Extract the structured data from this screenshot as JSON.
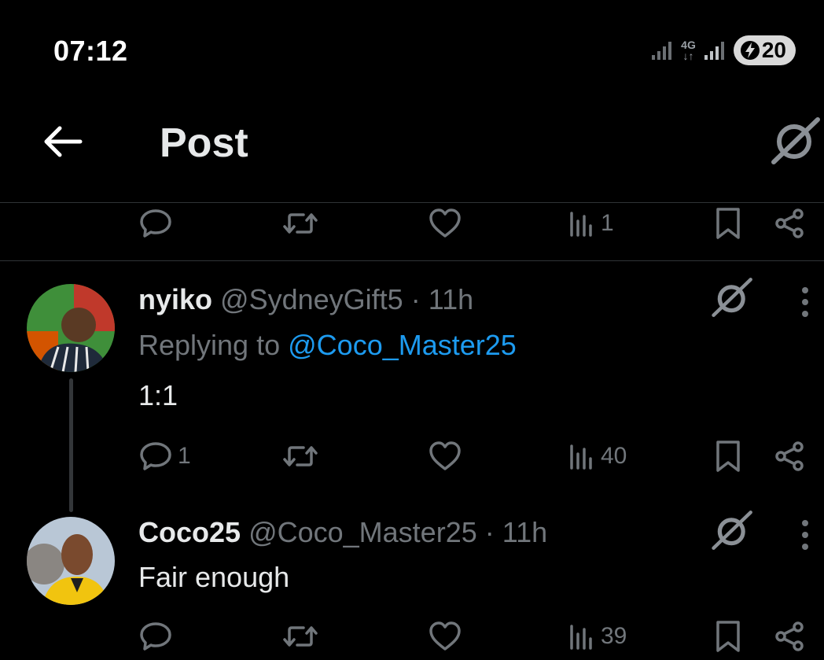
{
  "status": {
    "time": "07:12",
    "network": "4G",
    "battery": "20"
  },
  "header": {
    "title": "Post"
  },
  "top_actions": {
    "views": "1"
  },
  "tweets": [
    {
      "name": "nyiko",
      "handle": "@SydneyGift5",
      "separator": "·",
      "time": "11h",
      "replying_prefix": "Replying to",
      "replying_handle": "@Coco_Master25",
      "text": "1:1",
      "replies": "1",
      "views": "40"
    },
    {
      "name": "Coco25",
      "handle": "@Coco_Master25",
      "separator": "·",
      "time": "11h",
      "text": "Fair enough",
      "views": "39"
    }
  ],
  "colors": {
    "background": "#000000",
    "text": "#e7e9ea",
    "muted": "#71767b",
    "link": "#1d9bf0"
  },
  "icons": [
    "back-arrow-icon",
    "grok-icon",
    "reply-icon",
    "repost-icon",
    "like-icon",
    "views-icon",
    "bookmark-icon",
    "share-icon",
    "more-icon",
    "signal-icon",
    "battery-charging-icon"
  ]
}
